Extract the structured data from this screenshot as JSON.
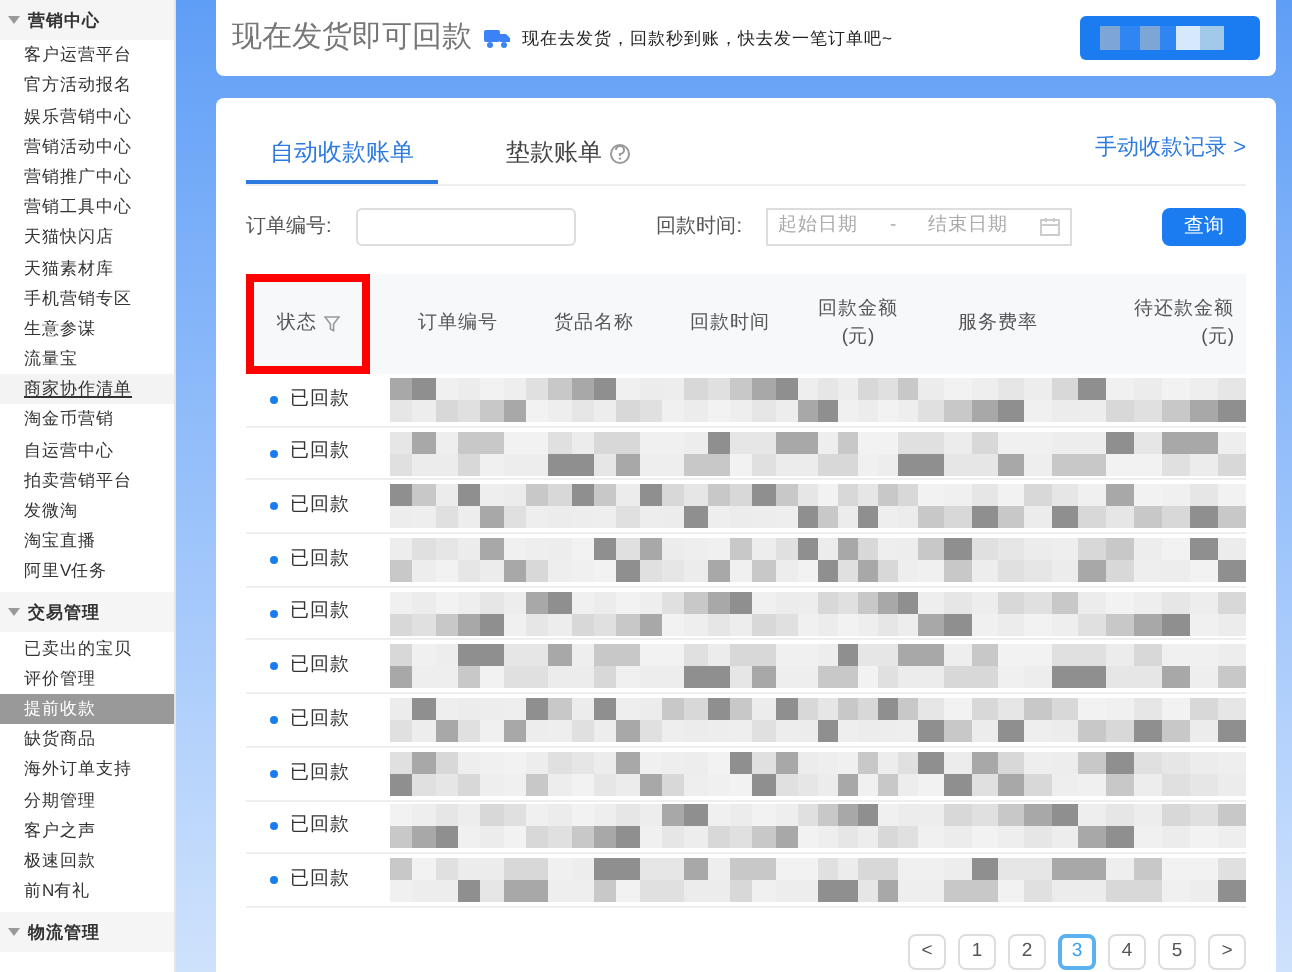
{
  "sidebar": {
    "sections": [
      {
        "title": "营销中心",
        "expanded": true,
        "items": [
          {
            "label": "客户运营平台",
            "selected": false
          },
          {
            "label": "官方活动报名",
            "selected": false
          },
          {
            "label": "娱乐营销中心",
            "selected": false
          },
          {
            "label": "营销活动中心",
            "selected": false
          },
          {
            "label": "营销推广中心",
            "selected": false
          },
          {
            "label": "营销工具中心",
            "selected": false
          },
          {
            "label": "天猫快闪店",
            "selected": false
          },
          {
            "label": "天猫素材库",
            "selected": false
          },
          {
            "label": "手机营销专区",
            "selected": false
          },
          {
            "label": "生意参谋",
            "selected": false
          },
          {
            "label": "流量宝",
            "selected": false
          },
          {
            "label": "商家协作清单",
            "selected": false,
            "hovered": true
          },
          {
            "label": "淘金币营销",
            "selected": false
          },
          {
            "label": "自运营中心",
            "selected": false
          },
          {
            "label": "拍卖营销平台",
            "selected": false
          },
          {
            "label": "发微淘",
            "selected": false
          },
          {
            "label": "淘宝直播",
            "selected": false
          },
          {
            "label": "阿里V任务",
            "selected": false
          }
        ]
      },
      {
        "title": "交易管理",
        "expanded": true,
        "items": [
          {
            "label": "已卖出的宝贝",
            "selected": false
          },
          {
            "label": "评价管理",
            "selected": false
          },
          {
            "label": "提前收款",
            "selected": true
          },
          {
            "label": "缺货商品",
            "selected": false
          },
          {
            "label": "海外订单支持",
            "selected": false
          },
          {
            "label": "分期管理",
            "selected": false
          },
          {
            "label": "客户之声",
            "selected": false
          },
          {
            "label": "极速回款",
            "selected": false
          },
          {
            "label": "前N有礼",
            "selected": false
          }
        ]
      },
      {
        "title": "物流管理",
        "expanded": true
      }
    ]
  },
  "banner": {
    "title": "现在发货即可回款",
    "note": "现在去发货，回款秒到账，快去发一笔订单吧~"
  },
  "tabs": [
    {
      "label": "自动收款账单",
      "selected": true,
      "help": false
    },
    {
      "label": "垫款账单",
      "selected": false,
      "help": true
    }
  ],
  "records_link": "手动收款记录 >",
  "filters": {
    "order_label": "订单编号:",
    "time_label": "回款时间:",
    "start_placeholder": "起始日期",
    "separator": "-",
    "end_placeholder": "结束日期",
    "query_button": "查询"
  },
  "table": {
    "columns": [
      {
        "label": "状态",
        "filter": true,
        "highlighted": true
      },
      {
        "label": "订单编号",
        "filter": false,
        "highlighted": false
      },
      {
        "label": "货品名称",
        "filter": false,
        "highlighted": false
      },
      {
        "label": "回款时间",
        "filter": false,
        "highlighted": false
      },
      {
        "label": "回款金额\n(元)",
        "filter": false,
        "highlighted": false
      },
      {
        "label": "服务费率",
        "filter": false,
        "highlighted": false
      },
      {
        "label": "待还款金额\n(元)",
        "filter": false,
        "highlighted": false
      }
    ],
    "rows": [
      {
        "status": "已回款"
      },
      {
        "status": "已回款"
      },
      {
        "status": "已回款"
      },
      {
        "status": "已回款"
      },
      {
        "status": "已回款"
      },
      {
        "status": "已回款"
      },
      {
        "status": "已回款"
      },
      {
        "status": "已回款"
      },
      {
        "status": "已回款"
      },
      {
        "status": "已回款"
      }
    ]
  },
  "pagination": {
    "prev": "<",
    "next": ">",
    "pages": [
      {
        "label": "1",
        "selected": false
      },
      {
        "label": "2",
        "selected": false
      },
      {
        "label": "3",
        "selected": true
      },
      {
        "label": "4",
        "selected": false
      },
      {
        "label": "5",
        "selected": false
      }
    ]
  }
}
